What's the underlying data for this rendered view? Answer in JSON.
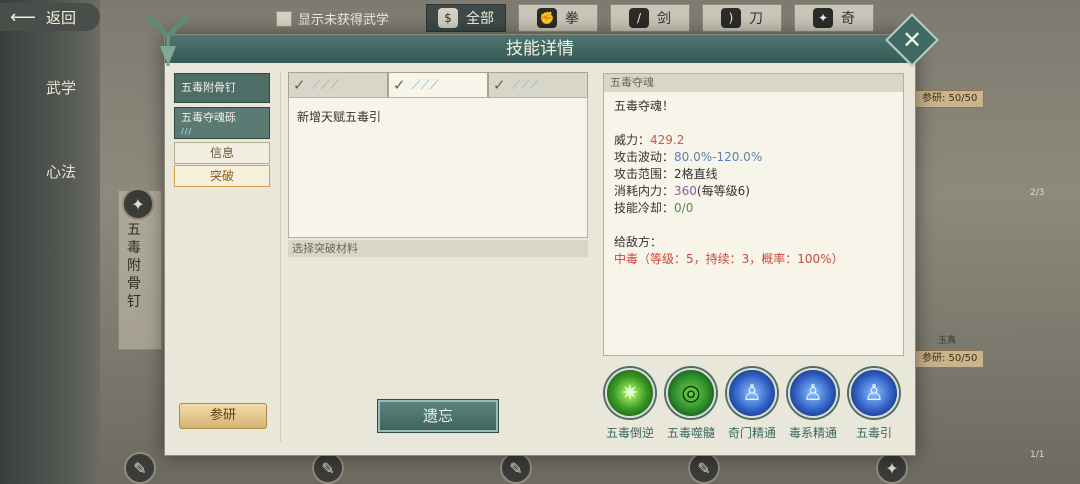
{
  "topbar": {
    "back_label": "返回",
    "show_unobtained_label": "显示未获得武学",
    "filters": [
      {
        "label": "全部",
        "icon": "money-bag-icon",
        "active": true
      },
      {
        "label": "拳",
        "icon": "fist-icon",
        "active": false
      },
      {
        "label": "剑",
        "icon": "sword-icon",
        "active": false
      },
      {
        "label": "刀",
        "icon": "blade-icon",
        "active": false
      },
      {
        "label": "奇",
        "icon": "shuriken-icon",
        "active": false
      }
    ]
  },
  "sidebar": {
    "tabs": [
      {
        "label": "武学"
      },
      {
        "label": "心法"
      }
    ]
  },
  "background": {
    "card_name": "五毒附骨钉",
    "research_label": "参研: 50/50",
    "research_label_2": "参研: 50/50",
    "count_1": "2/3",
    "count_2": "1/1",
    "card_caption": "玉真"
  },
  "dialog": {
    "title": "技能详情",
    "skill_list": [
      {
        "name": "五毒附骨钉"
      },
      {
        "name": "五毒夺魂砾",
        "level_swords": "///"
      }
    ],
    "subtabs": [
      {
        "label": "信息"
      },
      {
        "label": "突破"
      }
    ],
    "research_button": "参研",
    "level_tabs": [
      {
        "icon": "check-icon",
        "filled": 1
      },
      {
        "icon": "check-icon",
        "filled": 2
      },
      {
        "icon": "check-icon",
        "filled": 3
      }
    ],
    "talent_text": "新增天赋五毒引",
    "materials_header": "选择突破材料",
    "forget_button": "遗忘",
    "info": {
      "title": "五毒夺魂",
      "subtitle": "五毒夺魂！",
      "power_label": "威力：",
      "power_value": "429.2",
      "fluct_label": "攻击波动：",
      "fluct_value": "80.0%-120.0%",
      "range_label": "攻击范围：",
      "range_value": "2格直线",
      "cost_label": "消耗内力：",
      "cost_value": "360",
      "cost_extra": "(每等级6)",
      "cooldown_label": "技能冷却：",
      "cooldown_value": "0/0",
      "enemy_label": "给敌方：",
      "enemy_effect": "中毒（等级：5，持续：3，概率：100%）"
    },
    "talents": [
      {
        "label": "五毒倒逆",
        "icon": "green-flame-icon"
      },
      {
        "label": "五毒噬髓",
        "icon": "green-swirl-icon"
      },
      {
        "label": "奇门精通",
        "icon": "meditating-figure-icon"
      },
      {
        "label": "毒系精通",
        "icon": "meditating-figure-icon"
      },
      {
        "label": "五毒引",
        "icon": "meditating-figure-icon"
      }
    ]
  },
  "colors": {
    "header": "#365a55",
    "accent_red": "#c45a4c",
    "accent_blue": "#5b82b3",
    "accent_green": "#5a8a58"
  }
}
